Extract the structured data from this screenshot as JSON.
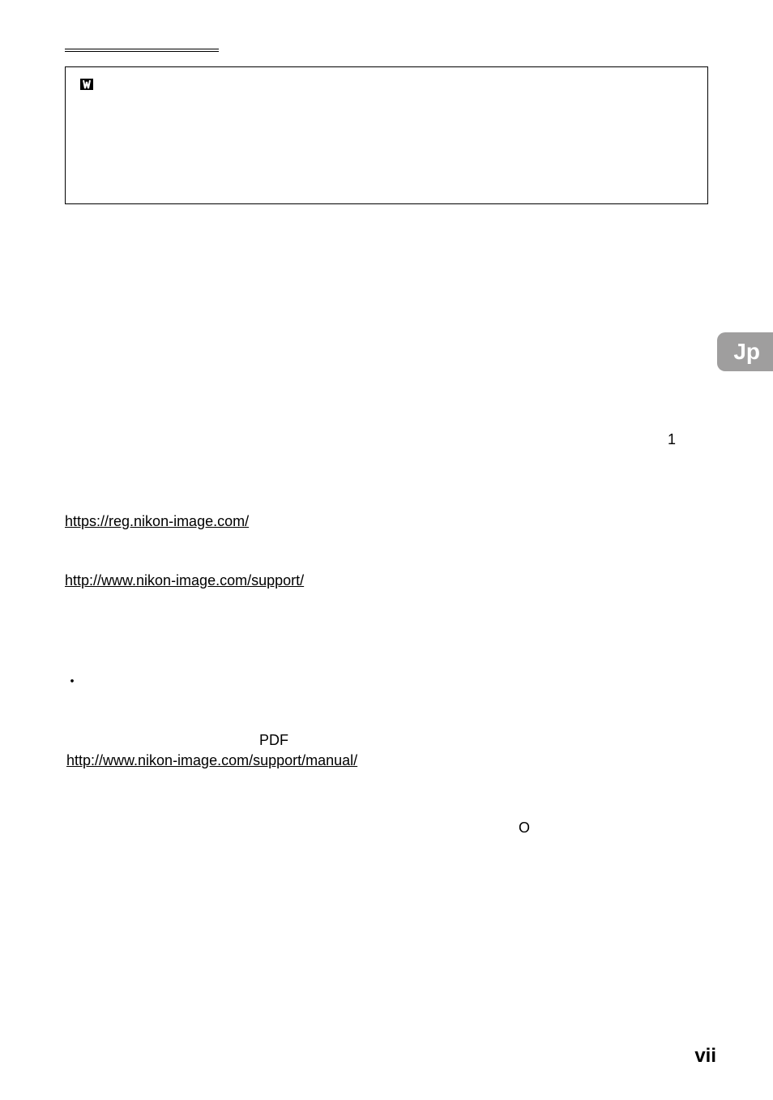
{
  "rightNumber": "1",
  "languageTab": "Jp",
  "links": {
    "register": "https://reg.nikon-image.com/",
    "support": "http://www.nikon-image.com/support/",
    "manual": "http://www.nikon-image.com/support/manual/"
  },
  "bullet": "・",
  "pdfLabel": "PDF",
  "circleChar": "O",
  "pageNumber": "vii"
}
